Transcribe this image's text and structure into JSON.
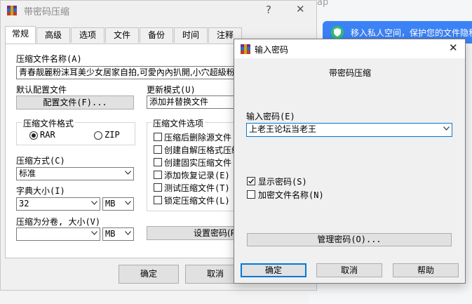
{
  "background": {
    "partial_text": "ap",
    "banner_text": "移入私人空间，保护您的文件隐私"
  },
  "main_dialog": {
    "title": "带密码压缩",
    "help_btn": "?",
    "close_btn": "✕",
    "tabs": [
      {
        "label": "常规",
        "active": true
      },
      {
        "label": "高级"
      },
      {
        "label": "选项"
      },
      {
        "label": "文件"
      },
      {
        "label": "备份"
      },
      {
        "label": "时间"
      },
      {
        "label": "注释"
      }
    ],
    "archive_name_label": "压缩文件名称(A)",
    "archive_name_value": "青春靓麗粉沫耳美少女居家自拍,可愛內內扒開,小穴超級粉嫩",
    "profiles_label": "默认配置文件",
    "profiles_button": "配置文件(F)...",
    "update_mode_label": "更新模式(U)",
    "update_mode_value": "添加并替换文件",
    "format_group_title": "压缩文件格式",
    "format_rar": "RAR",
    "format_zip": "ZIP",
    "method_label": "压缩方式(C)",
    "method_value": "标准",
    "dict_label": "字典大小(I)",
    "dict_value": "32",
    "dict_unit": "MB",
    "split_label": "压缩为分卷, 大小(V)",
    "split_value": "",
    "split_unit": "MB",
    "options_group_title": "压缩文件选项",
    "options": [
      "压缩后删除源文件",
      "创建自解压格式压缩",
      "创建固实压缩文件",
      "添加恢复记录(E)",
      "测试压缩文件(T)",
      "锁定压缩文件(L)"
    ],
    "set_password_button": "设置密码(P",
    "ok_button": "确定",
    "cancel_button": "取消"
  },
  "password_dialog": {
    "title": "输入密码",
    "close_btn": "✕",
    "heading": "带密码压缩",
    "enter_label": "输入密码(E)",
    "password_value": "上老王论坛当老王",
    "show_password_label": "显示密码(S)",
    "show_password_checked": true,
    "encrypt_names_label": "加密文件名称(N)",
    "encrypt_names_checked": false,
    "manage_button": "管理密码(O)...",
    "ok_button": "确定",
    "cancel_button": "取消",
    "help_button": "帮助"
  },
  "colors": {
    "banner": "#3b82f6",
    "dialog_bg": "#f0f0f0",
    "focus_border": "#0078d7"
  }
}
